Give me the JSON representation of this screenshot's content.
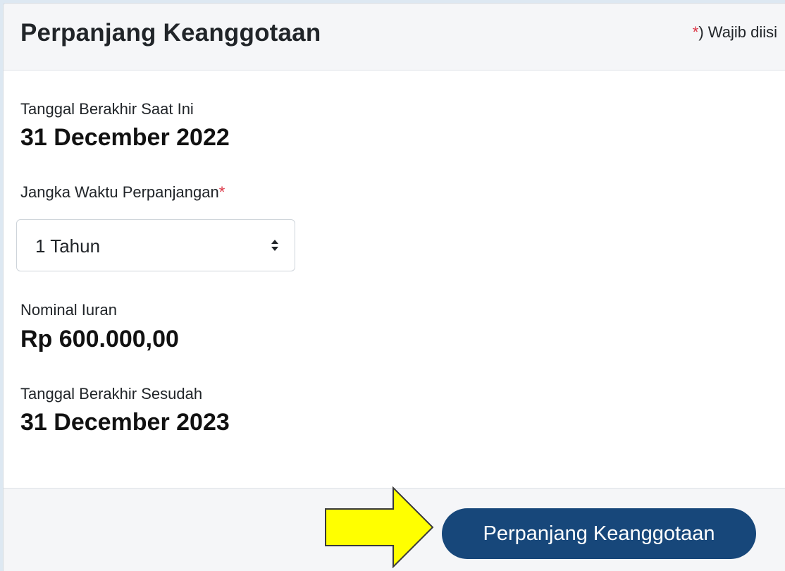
{
  "header": {
    "title": "Perpanjang Keanggotaan",
    "required_star": "*",
    "required_note": ") Wajib diisi"
  },
  "form": {
    "current_end_label": "Tanggal Berakhir Saat Ini",
    "current_end_value": "31 December 2022",
    "duration_label": "Jangka Waktu Perpanjangan",
    "duration_star": "*",
    "duration_selected": "1 Tahun",
    "fee_label": "Nominal Iuran",
    "fee_value": "Rp 600.000,00",
    "new_end_label": "Tanggal Berakhir Sesudah",
    "new_end_value": "31 December 2023"
  },
  "footer": {
    "submit_label": "Perpanjang Keanggotaan"
  },
  "icons": {
    "select_caret": "sort-caret-icon",
    "pointer_arrow": "arrow-right-icon"
  },
  "colors": {
    "accent": "#17477a",
    "required": "#dc3545",
    "arrow_fill": "#ffff00"
  }
}
